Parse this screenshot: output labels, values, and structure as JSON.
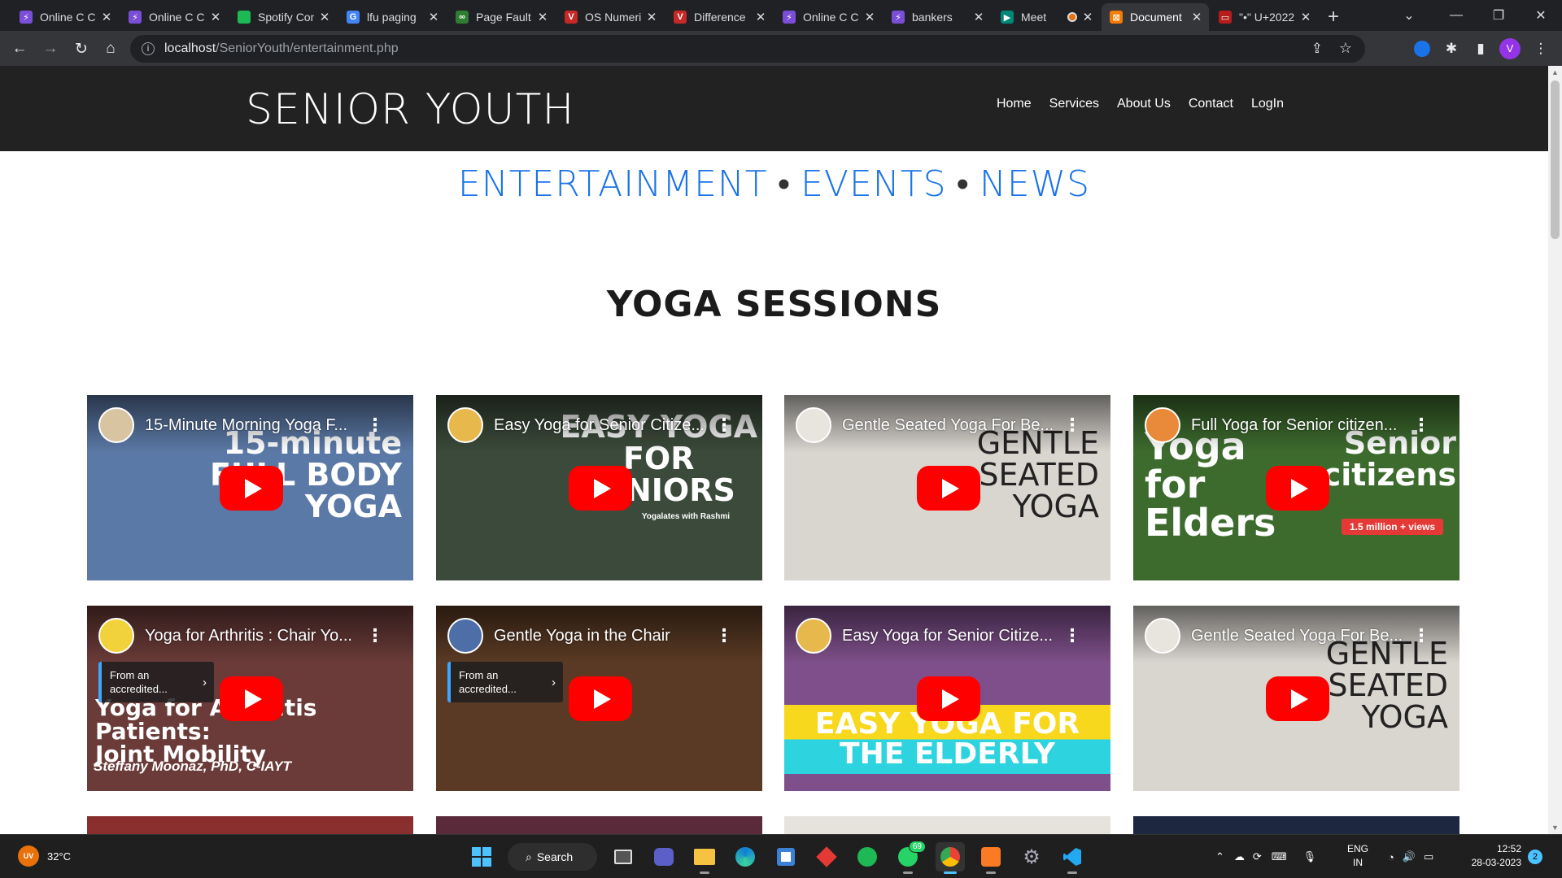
{
  "browser": {
    "tabs": [
      {
        "title": "Online C Compiler",
        "fav_color": "#7b4ed8",
        "fav_glyph": "⚡"
      },
      {
        "title": "Online C Compiler",
        "fav_color": "#7b4ed8",
        "fav_glyph": "⚡"
      },
      {
        "title": "Spotify Connect",
        "fav_color": "#1db954",
        "fav_glyph": ""
      },
      {
        "title": "lfu paging",
        "fav_color": "#4285f4",
        "fav_glyph": "G"
      },
      {
        "title": "Page Fault",
        "fav_color": "#2e7d32",
        "fav_glyph": "∞"
      },
      {
        "title": "OS Numerical",
        "fav_color": "#c62828",
        "fav_glyph": "V"
      },
      {
        "title": "Difference",
        "fav_color": "#c62828",
        "fav_glyph": "V"
      },
      {
        "title": "Online C Compiler",
        "fav_color": "#7b4ed8",
        "fav_glyph": "⚡"
      },
      {
        "title": "bankers",
        "fav_color": "#7b4ed8",
        "fav_glyph": "⚡"
      },
      {
        "title": "Meet",
        "fav_color": "#00897b",
        "fav_glyph": "▶"
      },
      {
        "title": "Document",
        "fav_color": "#f57c00",
        "fav_glyph": "⊠"
      },
      {
        "title": "\"•\" U+2022",
        "fav_color": "#b71c1c",
        "fav_glyph": "▭"
      }
    ],
    "url_host": "localhost",
    "url_path": "/SeniorYouth/entertainment.php",
    "profile_initial": "V"
  },
  "site": {
    "brand": "SENIOR YOUTH",
    "nav": [
      "Home",
      "Services",
      "About Us",
      "Contact",
      "LogIn"
    ],
    "subnav": [
      "ENTERTAINMENT",
      "EVENTS",
      "NEWS"
    ],
    "subnav_sep": "•",
    "section_title": "YOGA SESSIONS"
  },
  "videos": [
    {
      "title": "15-Minute Morning Yoga F...",
      "bg": "#5b79a6",
      "avatar": "#d8c4a0",
      "overlay": [
        "15-minute",
        "FULL BODY",
        "YOGA"
      ]
    },
    {
      "title": "Easy Yoga for Senior Citize...",
      "bg": "#3b4a3a",
      "avatar": "#e7b84c",
      "overlay": [
        "EASY YOGA",
        "FOR",
        "SENIORS"
      ],
      "caption": "Yogalates with Rashmi"
    },
    {
      "title": "Gentle Seated Yoga For Be...",
      "bg": "#d9d5cf",
      "avatar": "#e8e4de",
      "overlay": [
        "GENTLE",
        "SEATED",
        "YOGA"
      ]
    },
    {
      "title": "Full Yoga for Senior citizen...",
      "bg": "#3d6b2e",
      "avatar": "#e88a3a",
      "overlay": [
        "Yoga",
        "for",
        "Elders"
      ],
      "overlay2": [
        "Senior",
        "citizens"
      ],
      "badge": "1.5 million + views"
    },
    {
      "title": "Yoga for Arthritis : Chair Yo...",
      "bg": "#6a3b38",
      "avatar": "#f2d23b",
      "accredit": "From an accredited...",
      "overlay": [
        "Yoga for Arthritis Patients:",
        "Joint Mobility"
      ],
      "caption": "Steffany Moonaz, PhD, C-IAYT"
    },
    {
      "title": "Gentle Yoga in the Chair",
      "bg": "#5a3a24",
      "avatar": "#4e6ea8",
      "accredit": "From an accredited..."
    },
    {
      "title": "Easy Yoga for Senior Citize...",
      "bg": "#7e4f8a",
      "avatar": "#e7b84c",
      "overlay": [
        "EASY YOGA FOR",
        "THE ELDERLY"
      ]
    },
    {
      "title": "Gentle Seated Yoga For Be...",
      "bg": "#d9d5cf",
      "avatar": "#e8e4de",
      "overlay": [
        "GENTLE",
        "SEATED",
        "YOGA"
      ]
    }
  ],
  "taskbar": {
    "temperature": "32°C",
    "uv": "UV",
    "search_label": "Search",
    "lang_top": "ENG",
    "lang_bottom": "IN",
    "time": "12:52",
    "date": "28-03-2023",
    "notif_count": "2",
    "whatsapp_badge": "69"
  }
}
